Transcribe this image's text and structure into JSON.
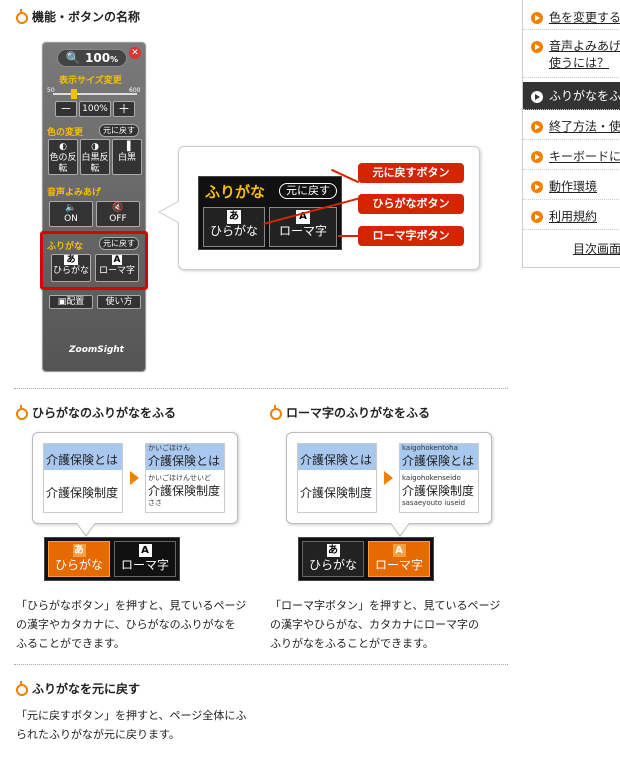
{
  "section_title": "機能・ボタンの名称",
  "nav": {
    "items": [
      {
        "label": "色を変更する",
        "active": false
      },
      {
        "label": "音声よみあげ",
        "label2": "使うには？",
        "active": false
      },
      {
        "label": "ふりがなをふる",
        "active": true
      },
      {
        "label": "終了方法・使",
        "active": false
      },
      {
        "label": "キーボードに",
        "active": false
      },
      {
        "label": "動作環境",
        "active": false
      },
      {
        "label": "利用規約",
        "active": false
      }
    ],
    "toc": "目次画面"
  },
  "panel": {
    "zoom": "100",
    "zoom_unit": "%",
    "size_title": "表示サイズ変更",
    "min_label": "50",
    "max_label": "600",
    "minus": "－",
    "size_value": "100%",
    "plus": "＋",
    "color_title": "色の変更",
    "color_reset": "元に戻す",
    "color_btns": [
      "色の反転",
      "白黒反転",
      "白黒"
    ],
    "voice_title": "音声よみあげ",
    "voice_on": "ON",
    "voice_off": "OFF",
    "furigana_title": "ふりがな",
    "furigana_reset": "元に戻す",
    "hira_sq": "あ",
    "hira": "ひらがな",
    "roma_sq": "A",
    "roma": "ローマ字",
    "layout": "配置",
    "howto": "使い方",
    "brand": "ZoomSight"
  },
  "callout": {
    "title": "ふりがな",
    "reset": "元に戻す",
    "hira_sq": "あ",
    "hira": "ひらがな",
    "roma_sq": "A",
    "roma": "ローマ字",
    "tags": [
      "元に戻すボタン",
      "ひらがなボタン",
      "ローマ字ボタン"
    ]
  },
  "hira_section": {
    "title": "ひらがなのふりがなをふる",
    "before_top": "介護保険とは",
    "before_line": "介護保険制度",
    "after_ruby_top": "かいごほけん",
    "after_top": "介護保険とは",
    "after_ruby_line": "かいごほけんせいど",
    "after_line": "介護保険制度",
    "after_extra": "ささ",
    "para": [
      "「ひらがなボタン」を押すと、見ているページ",
      "の漢字やカタカナに、ひらがなのふりがなを",
      "ふることができます。"
    ]
  },
  "roma_section": {
    "title": "ローマ字のふりがなをふる",
    "before_top": "介護保険とは",
    "before_line": "介護保険制度",
    "after_ruby_top": "kaigohokentoha",
    "after_top": "介護保険とは",
    "after_ruby_line": "kaigohokenseido",
    "after_line": "介護保険制度",
    "after_extra": "sasaeyouto iuseid",
    "para": [
      "「ローマ字ボタン」を押すと、見ているページ",
      "の漢字やひらがな、カタカナにローマ字の",
      "ふりがなをふることができます。"
    ]
  },
  "reset_section": {
    "title": "ふりがなを元に戻す",
    "para": [
      "「元に戻すボタン」を押すと、ページ全体にふ",
      "られたふりがなが元に戻ります。"
    ]
  },
  "colors": {
    "accent": "#f08000",
    "tag_red": "#d42400",
    "highlight": "#d00000",
    "orange_btn": "#e66a00"
  }
}
